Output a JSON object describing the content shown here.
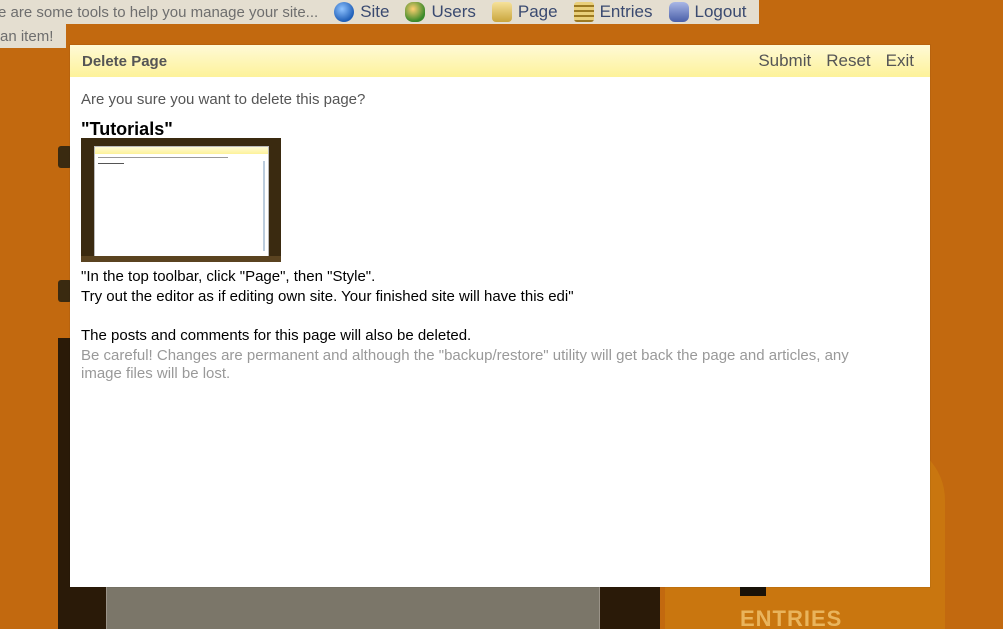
{
  "toolbar": {
    "intro": "e are some tools to help you manage your site...",
    "items": [
      {
        "label": "Site",
        "icon": "globe-icon"
      },
      {
        "label": "Users",
        "icon": "users-icon"
      },
      {
        "label": "Page",
        "icon": "page-icon"
      },
      {
        "label": "Entries",
        "icon": "entries-icon"
      },
      {
        "label": "Logout",
        "icon": "logout-icon"
      }
    ],
    "sub_hint": "an item!"
  },
  "background": {
    "entries_label": "ENTRIES"
  },
  "dialog": {
    "title": "Delete Page",
    "actions": {
      "submit": "Submit",
      "reset": "Reset",
      "exit": "Exit"
    },
    "question": "Are you sure you want to delete this page?",
    "page_name": "\"Tutorials\"",
    "excerpt": [
      "\"In the top toolbar, click \"Page\", then \"Style\".",
      "Try out the editor as if editing own site. Your finished site will have this edi\""
    ],
    "notice": "The posts and comments for this page will also be deleted.",
    "warning": "Be careful! Changes are permanent and although the \"backup/restore\" utility will get back the page and articles, any image files will be lost."
  },
  "colors": {
    "background": "#c2690f",
    "dialog_header": "#fdf29a",
    "muted_text": "#999999",
    "title_text": "#555555"
  }
}
